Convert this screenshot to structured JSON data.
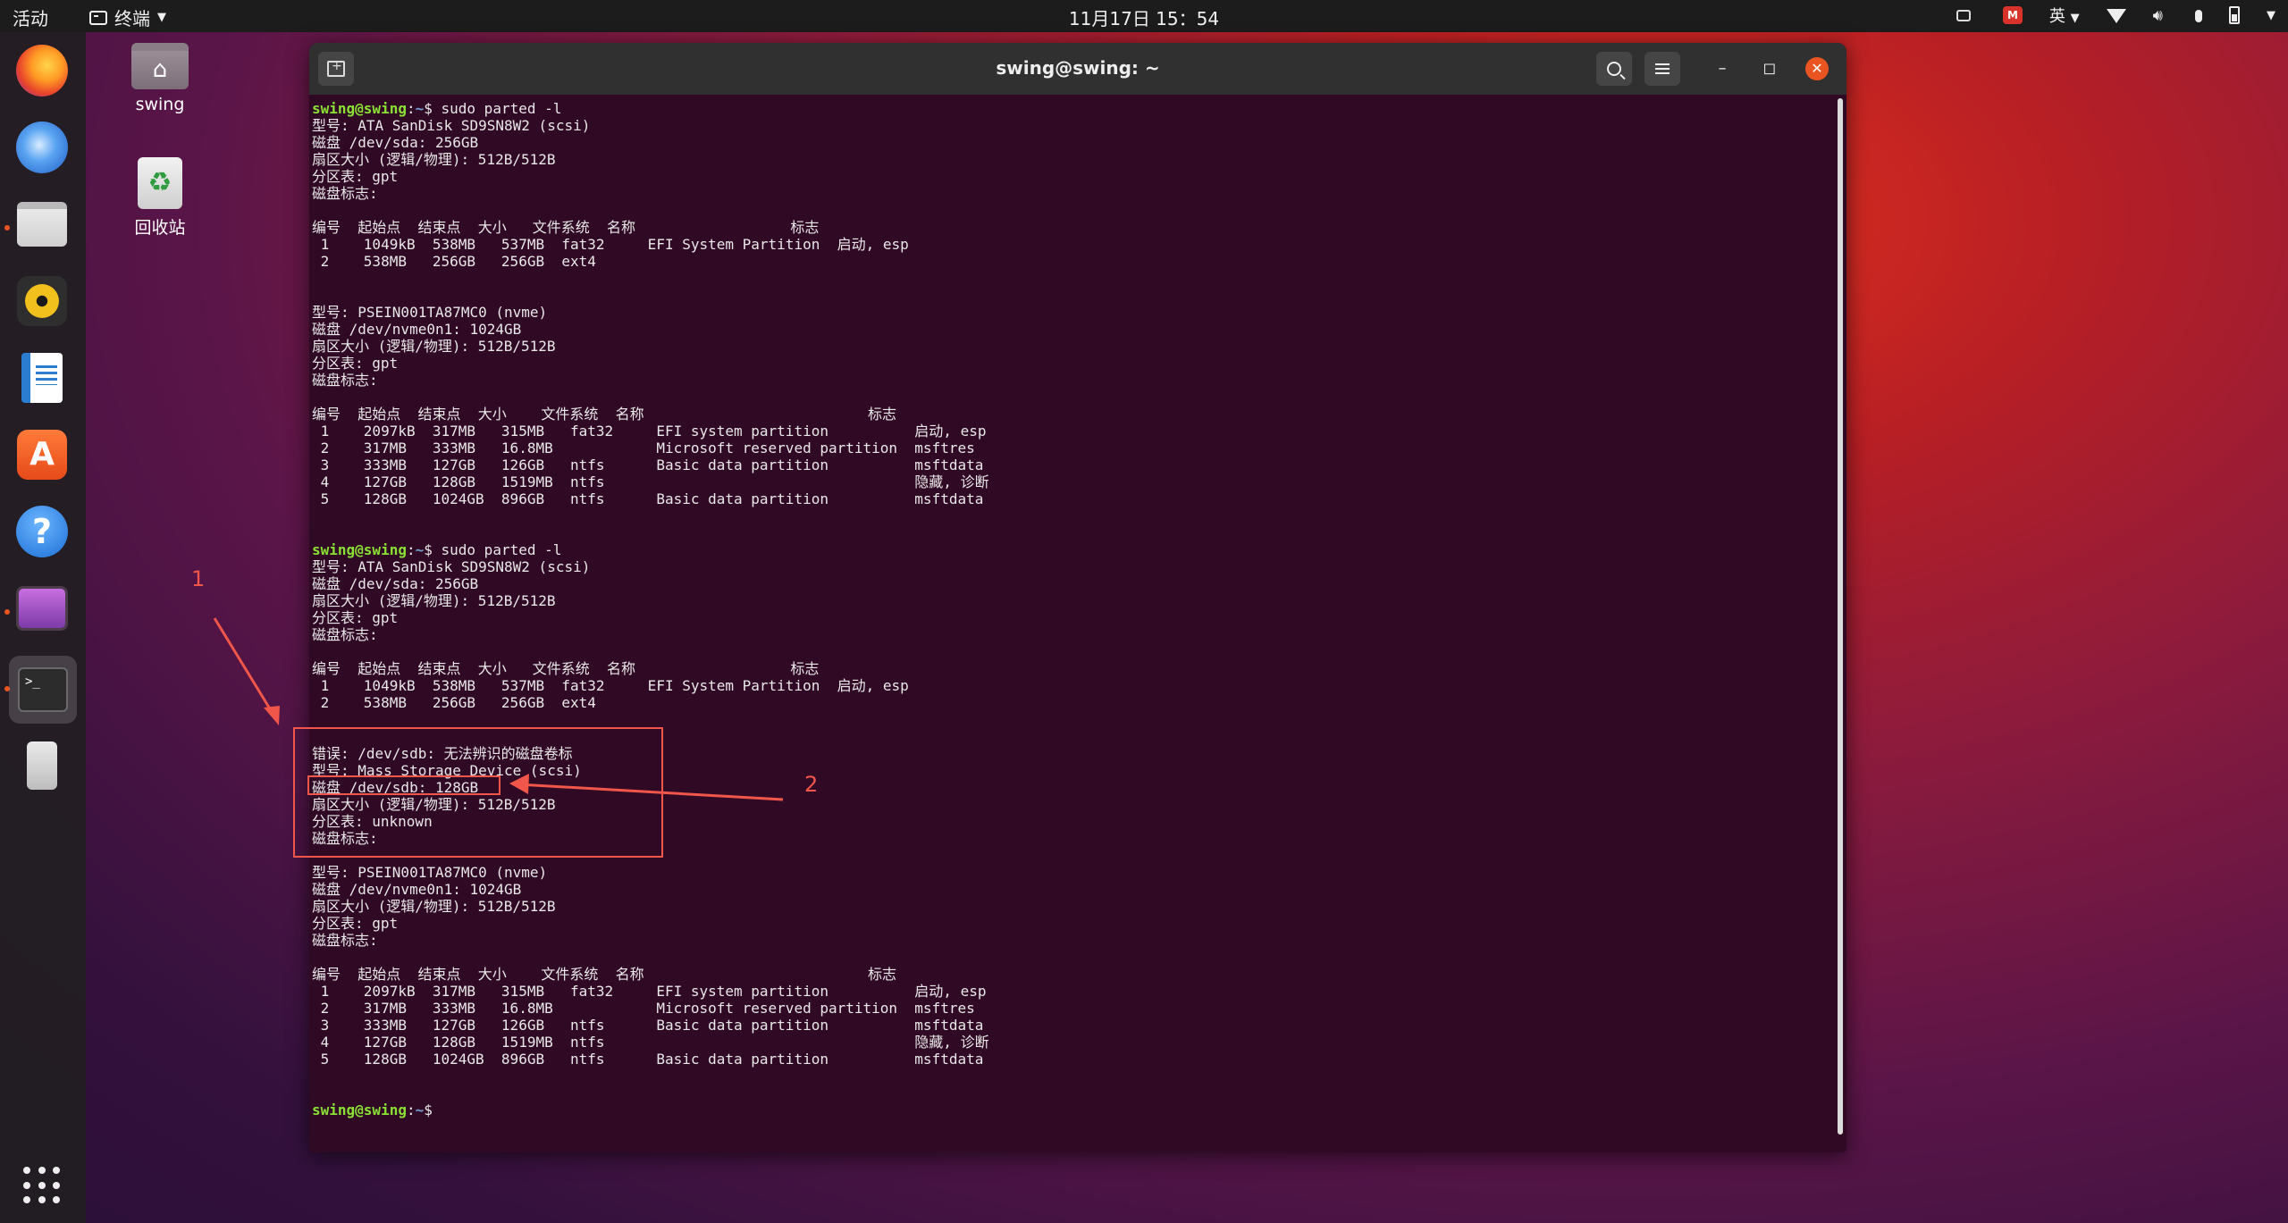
{
  "topbar": {
    "activities": "活动",
    "app_menu": "终端",
    "clock": "11月17日  15：54",
    "input_method": "英"
  },
  "desktop": {
    "home_label": "swing",
    "trash_label": "回收站"
  },
  "window": {
    "title": "swing@swing: ~"
  },
  "terminal": {
    "prompt_user": "swing@swing",
    "prompt_path": "~",
    "lines": [
      {
        "prompt": true,
        "cmd": "$ sudo parted -l"
      },
      {
        "text": "型号: ATA SanDisk SD9SN8W2 (scsi)"
      },
      {
        "text": "磁盘 /dev/sda: 256GB"
      },
      {
        "text": "扇区大小 (逻辑/物理): 512B/512B"
      },
      {
        "text": "分区表: gpt"
      },
      {
        "text": "磁盘标志:"
      },
      {
        "text": ""
      },
      {
        "text": "编号  起始点  结束点  大小   文件系统  名称                  标志"
      },
      {
        "text": " 1    1049kB  538MB   537MB  fat32     EFI System Partition  启动, esp"
      },
      {
        "text": " 2    538MB   256GB   256GB  ext4"
      },
      {
        "text": ""
      },
      {
        "text": ""
      },
      {
        "text": "型号: PSEIN001TA87MC0 (nvme)"
      },
      {
        "text": "磁盘 /dev/nvme0n1: 1024GB"
      },
      {
        "text": "扇区大小 (逻辑/物理): 512B/512B"
      },
      {
        "text": "分区表: gpt"
      },
      {
        "text": "磁盘标志:"
      },
      {
        "text": ""
      },
      {
        "text": "编号  起始点  结束点  大小    文件系统  名称                          标志"
      },
      {
        "text": " 1    2097kB  317MB   315MB   fat32     EFI system partition          启动, esp"
      },
      {
        "text": " 2    317MB   333MB   16.8MB            Microsoft reserved partition  msftres"
      },
      {
        "text": " 3    333MB   127GB   126GB   ntfs      Basic data partition          msftdata"
      },
      {
        "text": " 4    127GB   128GB   1519MB  ntfs                                    隐藏, 诊断"
      },
      {
        "text": " 5    128GB   1024GB  896GB   ntfs      Basic data partition          msftdata"
      },
      {
        "text": ""
      },
      {
        "text": ""
      },
      {
        "prompt": true,
        "cmd": "$ sudo parted -l"
      },
      {
        "text": "型号: ATA SanDisk SD9SN8W2 (scsi)"
      },
      {
        "text": "磁盘 /dev/sda: 256GB"
      },
      {
        "text": "扇区大小 (逻辑/物理): 512B/512B"
      },
      {
        "text": "分区表: gpt"
      },
      {
        "text": "磁盘标志:"
      },
      {
        "text": ""
      },
      {
        "text": "编号  起始点  结束点  大小   文件系统  名称                  标志"
      },
      {
        "text": " 1    1049kB  538MB   537MB  fat32     EFI System Partition  启动, esp"
      },
      {
        "text": " 2    538MB   256GB   256GB  ext4"
      },
      {
        "text": ""
      },
      {
        "text": ""
      },
      {
        "text": "错误: /dev/sdb: 无法辨识的磁盘卷标"
      },
      {
        "text": "型号: Mass Storage Device (scsi)"
      },
      {
        "text": "磁盘 /dev/sdb: 128GB"
      },
      {
        "text": "扇区大小 (逻辑/物理): 512B/512B"
      },
      {
        "text": "分区表: unknown"
      },
      {
        "text": "磁盘标志:"
      },
      {
        "text": ""
      },
      {
        "text": "型号: PSEIN001TA87MC0 (nvme)"
      },
      {
        "text": "磁盘 /dev/nvme0n1: 1024GB"
      },
      {
        "text": "扇区大小 (逻辑/物理): 512B/512B"
      },
      {
        "text": "分区表: gpt"
      },
      {
        "text": "磁盘标志:"
      },
      {
        "text": ""
      },
      {
        "text": "编号  起始点  结束点  大小    文件系统  名称                          标志"
      },
      {
        "text": " 1    2097kB  317MB   315MB   fat32     EFI system partition          启动, esp"
      },
      {
        "text": " 2    317MB   333MB   16.8MB            Microsoft reserved partition  msftres"
      },
      {
        "text": " 3    333MB   127GB   126GB   ntfs      Basic data partition          msftdata"
      },
      {
        "text": " 4    127GB   128GB   1519MB  ntfs                                    隐藏, 诊断"
      },
      {
        "text": " 5    128GB   1024GB  896GB   ntfs      Basic data partition          msftdata"
      },
      {
        "text": ""
      },
      {
        "text": ""
      },
      {
        "prompt": true,
        "cmd": "$ "
      }
    ]
  },
  "annotations": {
    "label_1": "1",
    "label_2": "2",
    "color": "#f0564a"
  },
  "colors": {
    "terminal_bg": "#300a24",
    "prompt_user": "#8ae234",
    "prompt_path": "#729fcf",
    "accent": "#e95420"
  },
  "icons": {
    "dock": [
      "firefox-icon",
      "thunderbird-icon",
      "files-icon",
      "rhythmbox-icon",
      "writer-icon",
      "software-icon",
      "help-icon",
      "video-icon",
      "terminal-icon",
      "usb-drive-icon",
      "app-grid-icon"
    ]
  }
}
